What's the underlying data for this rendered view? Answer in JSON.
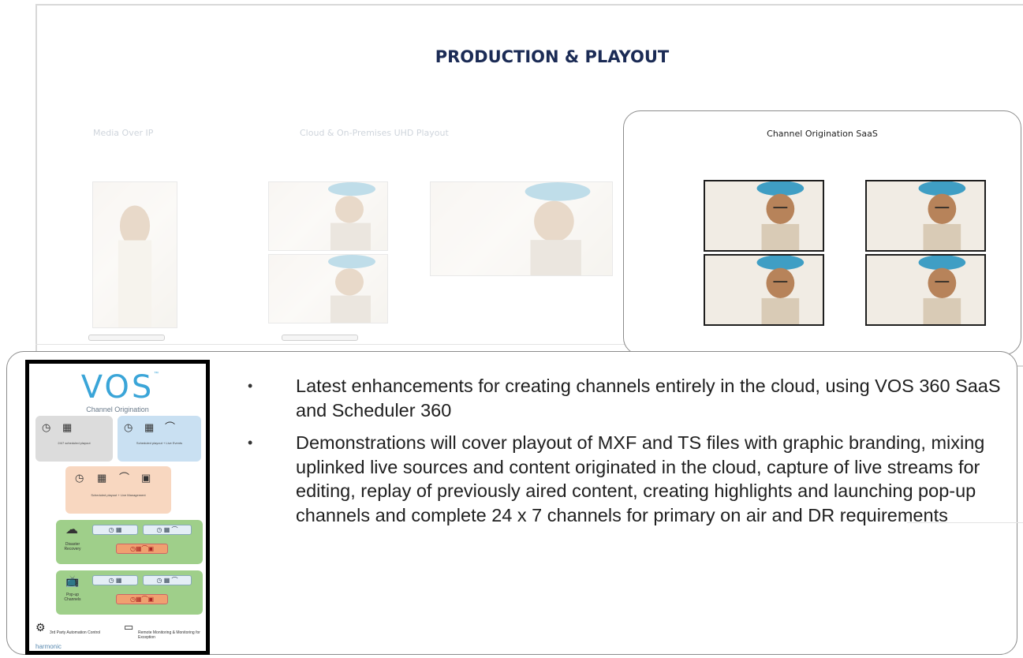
{
  "page": {
    "title": "PRODUCTION & PLAYOUT"
  },
  "faded_sections": [
    {
      "label": "Media Over IP"
    },
    {
      "label": "Cloud & On-Premises UHD Playout"
    }
  ],
  "saas_panel": {
    "title": "Channel Origination SaaS"
  },
  "vos_card": {
    "logo": "VOS",
    "trademark": "™",
    "subtitle": "Channel Origination",
    "box1_caption": "24/7 scheduled playout",
    "box2_caption": "Scheduled playout + Live Events",
    "box3_caption": "Scheduled playout + Live Management",
    "box4_side": "Disaster Recovery",
    "box5_side": "Pop-up Channels",
    "footer_left": "3rd Party Automation Control",
    "footer_right": "Remote Monitoring & Monitoring for Exception",
    "brand": "harmonic"
  },
  "bullets": [
    "Latest enhancements for creating channels entirely in the cloud, using VOS 360 SaaS and Scheduler 360",
    "Demonstrations will cover playout of MXF and TS files with graphic branding, mixing uplinked live sources and content originated in the cloud, capture of live streams for editing, replay of previously aired content, creating highlights and launching pop-up channels and complete 24 x 7 channels for primary on air and DR requirements"
  ],
  "bullet_glyph": "•",
  "colors": {
    "title": "#1b2b55",
    "vos_blue": "#3aa5d8",
    "panel_border": "#8c8c8c"
  }
}
